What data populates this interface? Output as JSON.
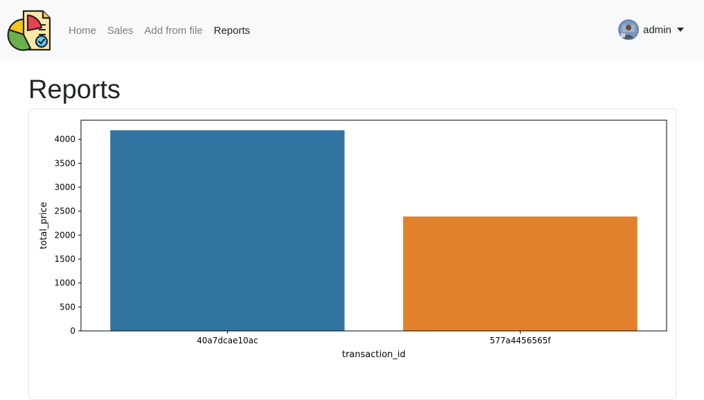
{
  "nav": {
    "links": [
      {
        "label": "Home",
        "active": false
      },
      {
        "label": "Sales",
        "active": false
      },
      {
        "label": "Add from file",
        "active": false
      },
      {
        "label": "Reports",
        "active": true
      }
    ],
    "user": {
      "name": "admin"
    }
  },
  "page": {
    "title": "Reports"
  },
  "icons": {
    "brand": "pie-chart-report-icon",
    "avatar": "user-avatar",
    "caret": "caret-down-icon"
  },
  "colors": {
    "navbar_bg": "#f8f9fa",
    "bar_1": "#3274a1",
    "bar_2": "#e1812c"
  },
  "chart_data": {
    "type": "bar",
    "categories": [
      "40a7dcae10ac",
      "577a4456565f"
    ],
    "values": [
      4190,
      2390
    ],
    "colors": [
      "#3274a1",
      "#e1812c"
    ],
    "xlabel": "transaction_id",
    "ylabel": "total_price",
    "ylim": [
      0,
      4400
    ],
    "yticks": [
      0,
      500,
      1000,
      1500,
      2000,
      2500,
      3000,
      3500,
      4000
    ],
    "grid": false
  }
}
